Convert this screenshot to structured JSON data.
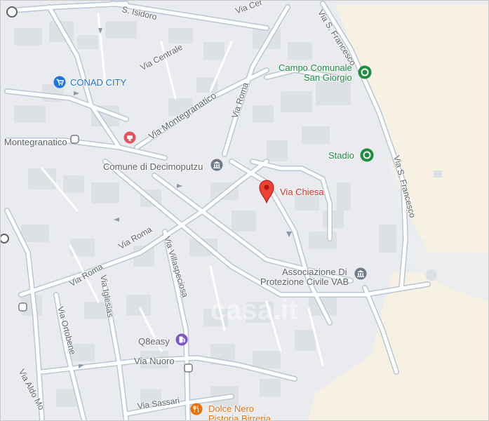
{
  "map": {
    "colors": {
      "background": "#e9ebee",
      "sand": "#f6f1e3",
      "road": "#ffffff",
      "road_casing": "#b9c6d6",
      "block": "#dde1e6",
      "pin_red": "#ea4335",
      "green_poi": "#1e8e3e",
      "blue_poi": "#1a73e8",
      "purple_poi": "#7e57c2",
      "orange_poi": "#e8710a"
    },
    "streets": {
      "s_isidoro": "S. Isidoro",
      "via_cer": "Via Cer",
      "via_s_francesco_top": "Via S. Francesco",
      "via_centrale": "Via Centrale",
      "via_montegranatico": "Via Montegranatico",
      "via_roma_north": "Via Roma",
      "montegranatico_west": "Montegranatico",
      "via_s_francesco_east": "Via S. Francesco",
      "via_roma_mid": "Via Roma",
      "via_roma_west": "Via Roma",
      "via_villaspeciosa": "Via Villaspeciosa",
      "via_iglesias": "Via Iglesias",
      "via_ortobene": "Via Ortobene",
      "via_aldo_mo": "Via Aldo Mo",
      "via_nuoro": "Via Nuoro",
      "via_sassari": "Via Sassari"
    },
    "pois": {
      "conad": "CONAD CITY",
      "campo_line1": "Campo Comunale",
      "campo_line2": "San Giorgio",
      "stadio": "Stadio",
      "comune": "Comune di Decimoputzu",
      "via_chiesa": "Via Chiesa",
      "assoc_line1": "Associazione Di",
      "assoc_line2": "Protezione Civile VAB",
      "q8": "Q8easy",
      "dolce_line1": "Dolce Nero",
      "dolce_line2": "Pistoria Birreria"
    },
    "icons": {
      "pin": "map-pin-icon",
      "shopping": "shopping-cart-icon",
      "park": "park-icon",
      "government": "government-building-icon",
      "fuel": "fuel-pump-icon",
      "restaurant": "restaurant-icon",
      "bus": "bus-stop-icon",
      "watermark": "casa.it"
    }
  }
}
